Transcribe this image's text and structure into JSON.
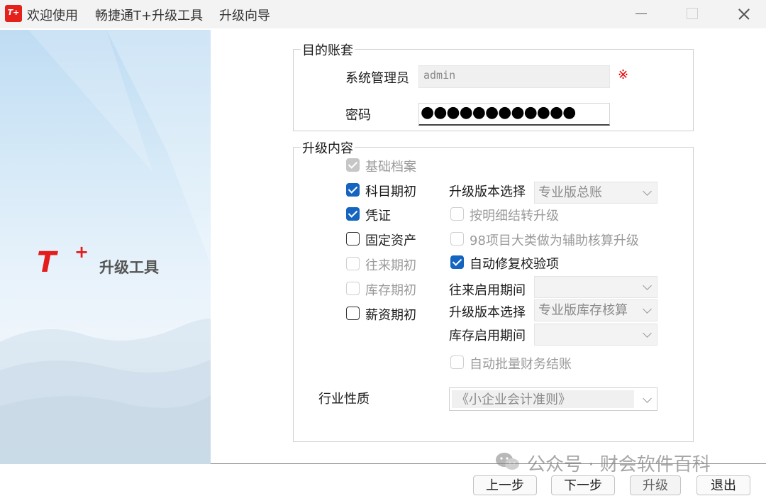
{
  "titlebar": {
    "app_icon_label": "T+",
    "title_1": "欢迎使用",
    "title_2": "畅捷通T+升级工具",
    "title_3": "升级向导"
  },
  "sidebar": {
    "logo_letter": "T",
    "logo_plus": "+",
    "logo_text": "升级工具"
  },
  "target_group": {
    "legend": "目的账套",
    "admin_label": "系统管理员",
    "admin_value": "admin",
    "required_mark": "※",
    "password_label": "密码",
    "password_mask": "●●●●●●●●●●●●"
  },
  "upgrade_group": {
    "legend": "升级内容",
    "left_options": [
      {
        "label": "基础档案",
        "state": "checked-disabled"
      },
      {
        "label": "科目期初",
        "state": "checked"
      },
      {
        "label": "凭证",
        "state": "checked"
      },
      {
        "label": "固定资产",
        "state": "unchecked"
      },
      {
        "label": "往来期初",
        "state": "disabled"
      },
      {
        "label": "库存期初",
        "state": "disabled"
      },
      {
        "label": "薪资期初",
        "state": "unchecked"
      }
    ],
    "version_select_label_1": "升级版本选择",
    "version_select_value_1": "专业版总账",
    "detail_transfer": "按明细结转升级",
    "item98_upgrade": "98项目大类做为辅助核算升级",
    "auto_repair": "自动修复校验项",
    "ar_period_label": "往来启用期间",
    "ar_period_value": "",
    "version_select_label_2": "升级版本选择",
    "version_select_value_2": "专业版库存核算",
    "inv_period_label": "库存启用期间",
    "inv_period_value": "",
    "auto_batch_close": "自动批量财务结账",
    "industry_label": "行业性质",
    "industry_value": "《小企业会计准则》"
  },
  "buttons": {
    "prev": "上一步",
    "next": "下一步",
    "upgrade": "升级",
    "exit": "退出"
  },
  "watermark": {
    "text": "公众号 · 财会软件百科"
  },
  "colors": {
    "accent": "#1565c0",
    "brand_red": "#e31c1c"
  }
}
